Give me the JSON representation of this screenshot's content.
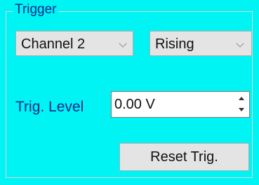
{
  "trigger": {
    "group_title": "Trigger",
    "channel_select": {
      "selected": "Channel 2",
      "icon": "chevron-down-icon"
    },
    "edge_select": {
      "selected": "Rising",
      "icon": "chevron-down-icon"
    },
    "level_label": "Trig. Level",
    "level_value": "0.00 V",
    "reset_label": "Reset Trig."
  },
  "colors": {
    "panel_background": "#00f4f4",
    "label_text": "#0a2a8a",
    "control_background": "#e4e4e4"
  }
}
